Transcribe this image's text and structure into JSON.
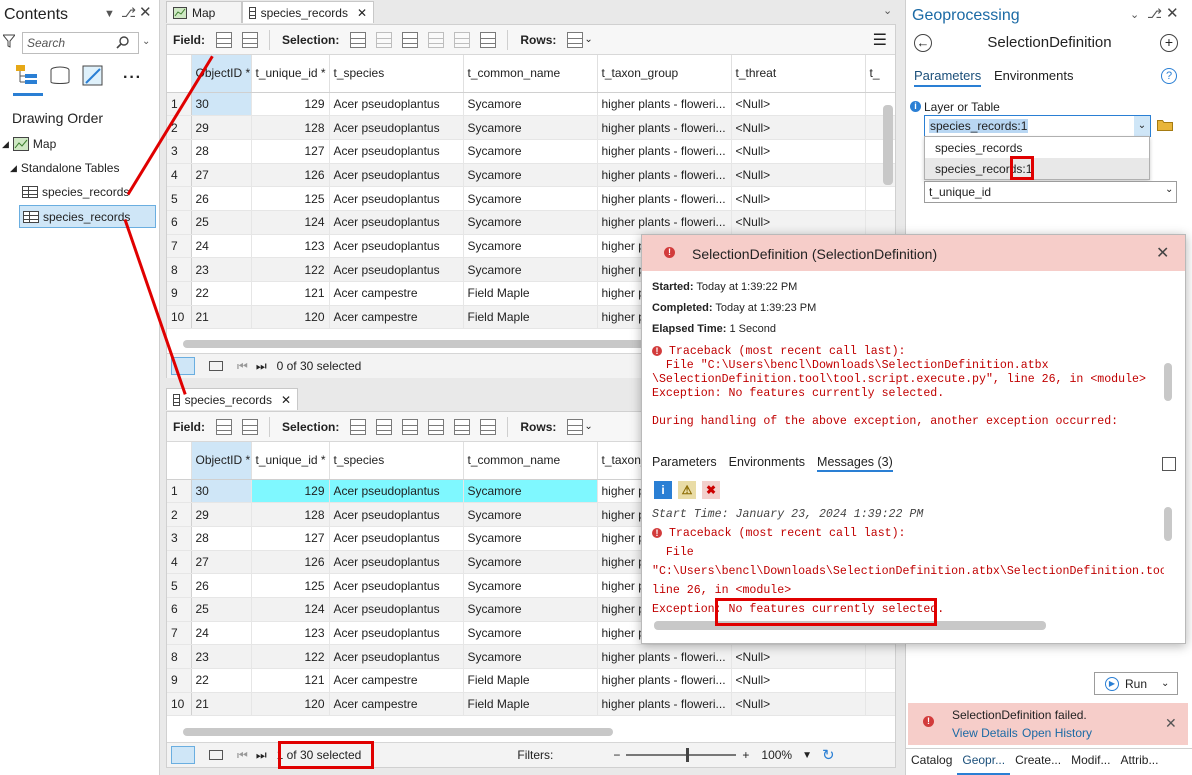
{
  "contents": {
    "title": "Contents",
    "search_placeholder": "Search",
    "drawing_order": "Drawing Order",
    "map_label": "Map",
    "standalone_tables": "Standalone Tables",
    "tables": [
      "species_records",
      "species_records"
    ]
  },
  "tabs_top": {
    "map": "Map",
    "table": "species_records"
  },
  "tab_bottom": "species_records",
  "toolbar": {
    "field": "Field:",
    "selection": "Selection:",
    "rows": "Rows:"
  },
  "columns": [
    "ObjectID *",
    "t_unique_id *",
    "t_species",
    "t_common_name",
    "t_taxon_group",
    "t_threat",
    "t_"
  ],
  "rows": [
    {
      "n": "1",
      "oid": "30",
      "uid": "129",
      "species": "Acer pseudoplantus",
      "common": "Sycamore",
      "taxon": "higher plants - floweri...",
      "threat": "<Null>"
    },
    {
      "n": "2",
      "oid": "29",
      "uid": "128",
      "species": "Acer pseudoplantus",
      "common": "Sycamore",
      "taxon": "higher plants - floweri...",
      "threat": "<Null>"
    },
    {
      "n": "3",
      "oid": "28",
      "uid": "127",
      "species": "Acer pseudoplantus",
      "common": "Sycamore",
      "taxon": "higher plants - floweri...",
      "threat": "<Null>"
    },
    {
      "n": "4",
      "oid": "27",
      "uid": "126",
      "species": "Acer pseudoplantus",
      "common": "Sycamore",
      "taxon": "higher plants - floweri...",
      "threat": "<Null>"
    },
    {
      "n": "5",
      "oid": "26",
      "uid": "125",
      "species": "Acer pseudoplantus",
      "common": "Sycamore",
      "taxon": "higher plants - floweri...",
      "threat": "<Null>"
    },
    {
      "n": "6",
      "oid": "25",
      "uid": "124",
      "species": "Acer pseudoplantus",
      "common": "Sycamore",
      "taxon": "higher plants - floweri...",
      "threat": "<Null>"
    },
    {
      "n": "7",
      "oid": "24",
      "uid": "123",
      "species": "Acer pseudoplantus",
      "common": "Sycamore",
      "taxon": "higher p",
      "threat": ""
    },
    {
      "n": "8",
      "oid": "23",
      "uid": "122",
      "species": "Acer pseudoplantus",
      "common": "Sycamore",
      "taxon": "higher p",
      "threat": ""
    },
    {
      "n": "9",
      "oid": "22",
      "uid": "121",
      "species": "Acer campestre",
      "common": "Field Maple",
      "taxon": "higher p",
      "threat": ""
    },
    {
      "n": "10",
      "oid": "21",
      "uid": "120",
      "species": "Acer campestre",
      "common": "Field Maple",
      "taxon": "higher p",
      "threat": ""
    }
  ],
  "rows_bottom": [
    {
      "n": "1",
      "oid": "30",
      "uid": "129",
      "species": "Acer pseudoplantus",
      "common": "Sycamore",
      "taxon": "higher p",
      "threat": ""
    },
    {
      "n": "2",
      "oid": "29",
      "uid": "128",
      "species": "Acer pseudoplantus",
      "common": "Sycamore",
      "taxon": "higher p",
      "threat": ""
    },
    {
      "n": "3",
      "oid": "28",
      "uid": "127",
      "species": "Acer pseudoplantus",
      "common": "Sycamore",
      "taxon": "higher p",
      "threat": ""
    },
    {
      "n": "4",
      "oid": "27",
      "uid": "126",
      "species": "Acer pseudoplantus",
      "common": "Sycamore",
      "taxon": "higher p",
      "threat": ""
    },
    {
      "n": "5",
      "oid": "26",
      "uid": "125",
      "species": "Acer pseudoplantus",
      "common": "Sycamore",
      "taxon": "higher p",
      "threat": ""
    },
    {
      "n": "6",
      "oid": "25",
      "uid": "124",
      "species": "Acer pseudoplantus",
      "common": "Sycamore",
      "taxon": "higher p",
      "threat": ""
    },
    {
      "n": "7",
      "oid": "24",
      "uid": "123",
      "species": "Acer pseudoplantus",
      "common": "Sycamore",
      "taxon": "higher p",
      "threat": ""
    },
    {
      "n": "8",
      "oid": "23",
      "uid": "122",
      "species": "Acer pseudoplantus",
      "common": "Sycamore",
      "taxon": "higher plants - floweri...",
      "threat": "<Null>"
    },
    {
      "n": "9",
      "oid": "22",
      "uid": "121",
      "species": "Acer campestre",
      "common": "Field Maple",
      "taxon": "higher plants - floweri...",
      "threat": "<Null>"
    },
    {
      "n": "10",
      "oid": "21",
      "uid": "120",
      "species": "Acer campestre",
      "common": "Field Maple",
      "taxon": "higher plants - floweri...",
      "threat": "<Null>"
    }
  ],
  "status_top": "0 of 30 selected",
  "status_bottom": "1 of 30 selected",
  "filters": "Filters:",
  "zoom": "100%",
  "gp": {
    "title": "Geoprocessing",
    "tool": "SelectionDefinition",
    "tab_params": "Parameters",
    "tab_env": "Environments",
    "param_label": "Layer or Table",
    "param_value": "species_records:1",
    "options": [
      "species_records",
      "species_records:1"
    ],
    "field_value": "t_unique_id",
    "run": "Run",
    "failed": "SelectionDefinition failed.",
    "view_details": "View Details",
    "open_history": "Open History",
    "bottom_tabs": [
      "Catalog",
      "Geopr...",
      "Create...",
      "Modif...",
      "Attrib..."
    ]
  },
  "popup": {
    "title": "SelectionDefinition (SelectionDefinition)",
    "started_label": "Started:",
    "started": "Today at 1:39:22 PM",
    "completed_label": "Completed:",
    "completed": "Today at 1:39:23 PM",
    "elapsed_label": "Elapsed Time:",
    "elapsed": "1 Second",
    "trace1": "Traceback (most recent call last):",
    "trace2": "  File \"C:\\Users\\bencl\\Downloads\\SelectionDefinition.atbx",
    "trace3": "\\SelectionDefinition.tool\\tool.script.execute.py\", line 26, in <module>",
    "trace4": "Exception: No features currently selected.",
    "trace5": "During handling of the above exception, another exception occurred:",
    "tabs": [
      "Parameters",
      "Environments",
      "Messages (3)"
    ],
    "start_time": "Start Time: January 23, 2024 1:39:22 PM",
    "m1": "Traceback (most recent call last):",
    "m2": "  File",
    "m3": "\"C:\\Users\\bencl\\Downloads\\SelectionDefinition.atbx\\SelectionDefinition.tool\\to",
    "m4": "line 26, in <module>",
    "m5a": "Exception: ",
    "m5b": "No features currently selected."
  }
}
